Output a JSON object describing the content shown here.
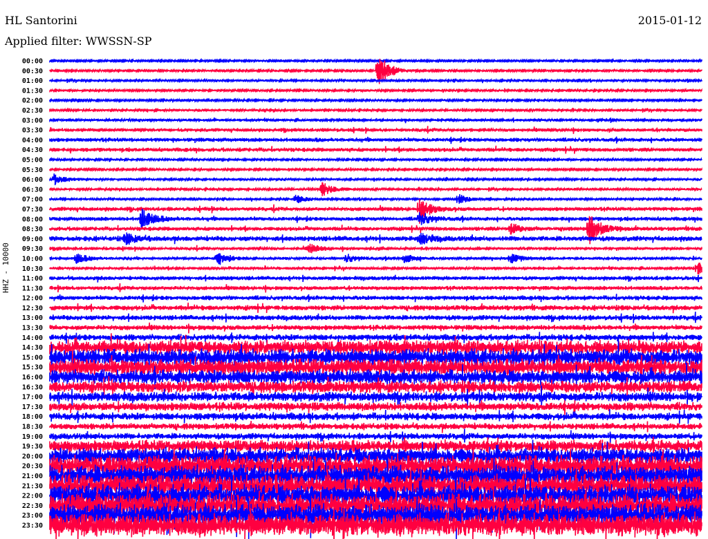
{
  "header": {
    "station": "HL Santorini",
    "date": "2015-01-12",
    "filter": "Applied filter: WWSSN-SP"
  },
  "chart_data": {
    "type": "line",
    "subtype": "helicorder",
    "title": "HL Santorini",
    "ylabel": "HHZ - 10000",
    "xlabel": "",
    "minutes_per_line": 30,
    "colors": [
      "#0000ff",
      "#ff0040"
    ],
    "lines": [
      "00:00",
      "00:30",
      "01:00",
      "01:30",
      "02:00",
      "02:30",
      "03:00",
      "03:30",
      "04:00",
      "04:30",
      "05:00",
      "05:30",
      "06:00",
      "06:30",
      "07:00",
      "07:30",
      "08:00",
      "08:30",
      "09:00",
      "09:30",
      "10:00",
      "10:30",
      "11:00",
      "11:30",
      "12:00",
      "12:30",
      "13:00",
      "13:30",
      "14:00",
      "14:30",
      "15:00",
      "15:30",
      "16:00",
      "16:30",
      "17:00",
      "17:30",
      "18:00",
      "18:30",
      "19:00",
      "19:30",
      "20:00",
      "20:30",
      "21:00",
      "21:30",
      "22:00",
      "22:30",
      "23:00",
      "23:30"
    ],
    "noise_level": [
      0.5,
      1,
      1.5,
      1,
      1,
      1.5,
      2,
      2.5,
      3,
      3,
      1,
      1,
      1.5,
      1.5,
      1.5,
      3,
      3,
      3,
      4,
      2,
      2,
      2,
      3,
      3,
      3.5,
      4,
      4,
      4,
      5,
      12,
      14,
      14,
      12,
      10,
      8,
      7,
      6,
      5,
      5,
      10,
      14,
      18,
      18,
      19,
      19,
      20,
      20,
      20
    ],
    "events": [
      {
        "line": 1,
        "minute": 15.1,
        "amplitude": 28
      },
      {
        "line": 12,
        "minute": 0.2,
        "amplitude": 8
      },
      {
        "line": 13,
        "minute": 12.5,
        "amplitude": 12
      },
      {
        "line": 14,
        "minute": 11.3,
        "amplitude": 6
      },
      {
        "line": 14,
        "minute": 18.8,
        "amplitude": 7
      },
      {
        "line": 15,
        "minute": 17.0,
        "amplitude": 16
      },
      {
        "line": 16,
        "minute": 4.2,
        "amplitude": 16
      },
      {
        "line": 16,
        "minute": 17.0,
        "amplitude": 10
      },
      {
        "line": 17,
        "minute": 24.8,
        "amplitude": 22
      },
      {
        "line": 17,
        "minute": 21.2,
        "amplitude": 7
      },
      {
        "line": 18,
        "minute": 3.5,
        "amplitude": 8
      },
      {
        "line": 18,
        "minute": 17.0,
        "amplitude": 8
      },
      {
        "line": 19,
        "minute": 11.9,
        "amplitude": 7
      },
      {
        "line": 20,
        "minute": 1.2,
        "amplitude": 7
      },
      {
        "line": 20,
        "minute": 7.7,
        "amplitude": 8
      },
      {
        "line": 20,
        "minute": 13.6,
        "amplitude": 6
      },
      {
        "line": 20,
        "minute": 16.3,
        "amplitude": 6
      },
      {
        "line": 20,
        "minute": 21.2,
        "amplitude": 7
      },
      {
        "line": 21,
        "minute": 29.8,
        "amplitude": 8
      }
    ]
  }
}
